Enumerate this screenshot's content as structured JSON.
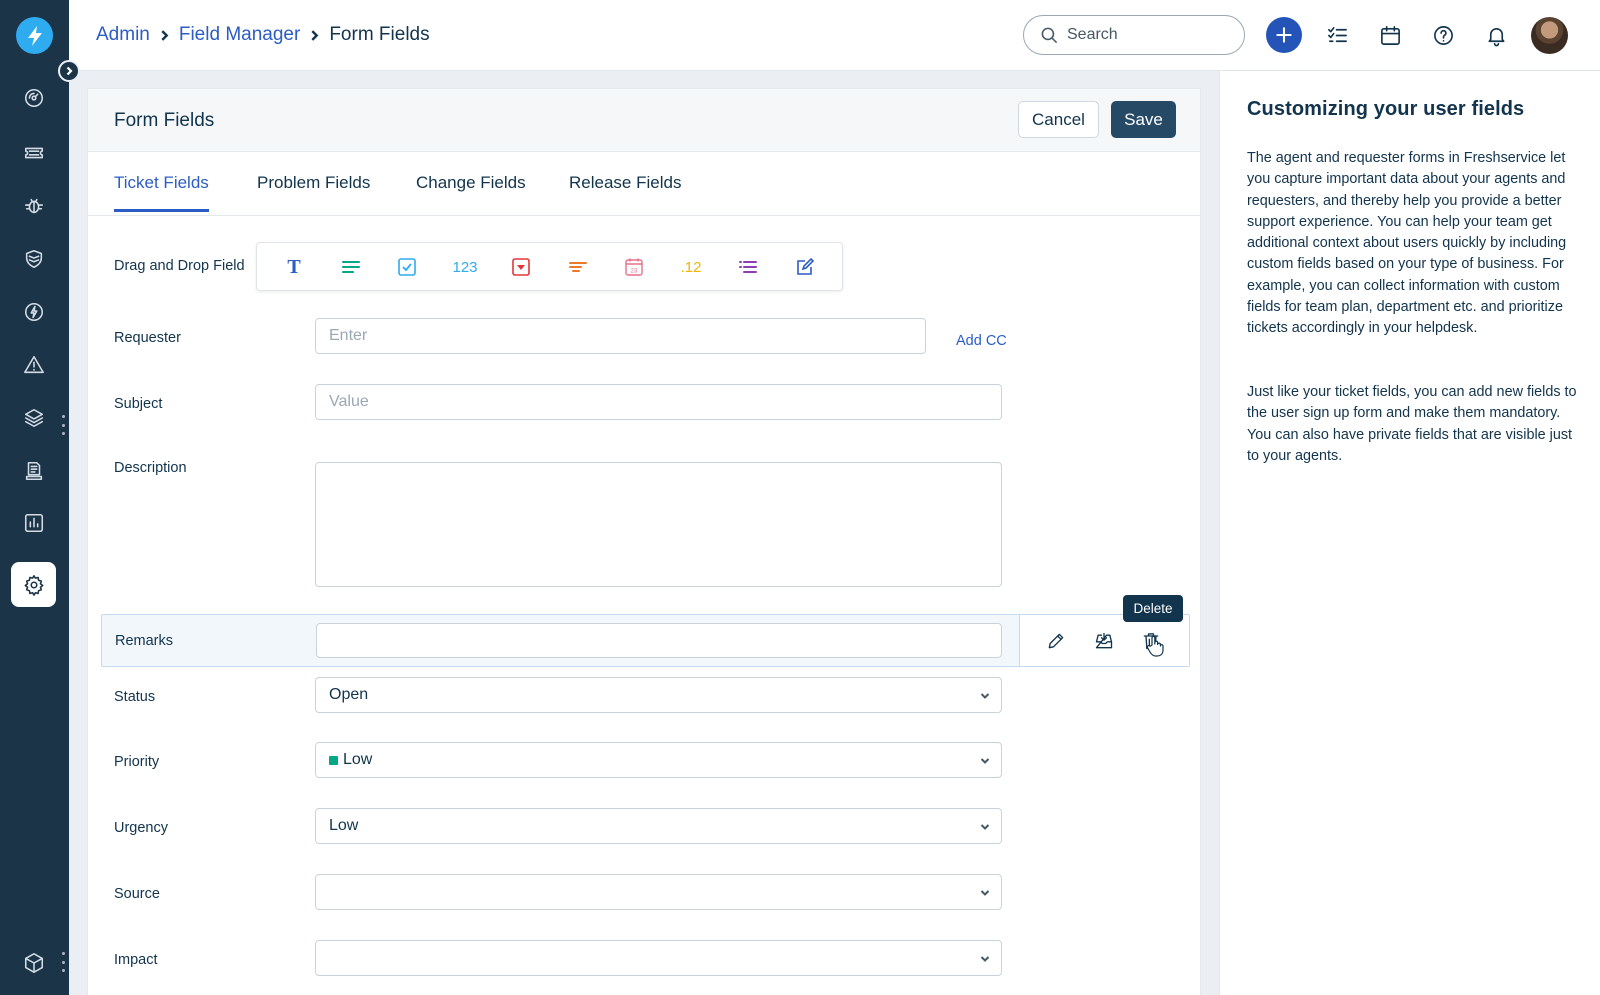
{
  "breadcrumb": {
    "admin": "Admin",
    "field_manager": "Field Manager",
    "current": "Form Fields"
  },
  "search": {
    "placeholder": "Search"
  },
  "card": {
    "title": "Form Fields",
    "cancel_label": "Cancel",
    "save_label": "Save"
  },
  "tabs": [
    {
      "label": "Ticket Fields",
      "active": true
    },
    {
      "label": "Problem Fields"
    },
    {
      "label": "Change Fields"
    },
    {
      "label": "Release Fields"
    }
  ],
  "toolbox": {
    "label": "Drag and Drop Field",
    "tools": [
      {
        "icon": "text-type-icon",
        "text": "T",
        "color": "#2c5cc5"
      },
      {
        "icon": "paragraph-icon",
        "color": "#00a886"
      },
      {
        "icon": "checkbox-icon",
        "color": "#2fabf0"
      },
      {
        "icon": "number-icon",
        "text": "123",
        "color": "#2fabf0"
      },
      {
        "icon": "dropdown-icon",
        "color": "#e43538"
      },
      {
        "icon": "dependent-field-icon",
        "color": "#ec7a2c"
      },
      {
        "icon": "date-icon",
        "text": "23",
        "color": "#e86f8c"
      },
      {
        "icon": "decimal-icon",
        "text": ".12",
        "color": "#f4b400"
      },
      {
        "icon": "list-icon",
        "color": "#8b3fb1"
      },
      {
        "icon": "edit-field-icon",
        "color": "#2c5cc5"
      }
    ]
  },
  "fields": {
    "requester": {
      "label": "Requester",
      "placeholder": "Enter",
      "add_cc": "Add CC"
    },
    "subject": {
      "label": "Subject",
      "placeholder": "Value"
    },
    "description": {
      "label": "Description"
    },
    "remarks": {
      "label": "Remarks",
      "tooltip": "Delete"
    },
    "status": {
      "label": "Status",
      "value": "Open"
    },
    "priority": {
      "label": "Priority",
      "value": "Low",
      "swatch_color": "#00a886"
    },
    "urgency": {
      "label": "Urgency",
      "value": "Low"
    },
    "source": {
      "label": "Source",
      "value": ""
    },
    "impact": {
      "label": "Impact",
      "value": ""
    }
  },
  "help": {
    "title": "Customizing your user fields",
    "p1": "The agent and requester forms in Freshservice let you capture important data about your agents and requesters, and thereby help you provide a better support experience. You can help your team get additional context about users quickly by including custom fields based on your type of business. For example, you can collect information with custom fields for team plan, department etc. and prioritize tickets accordingly in your helpdesk.",
    "p2": "Just like your ticket fields, you can add new fields to the user sign up form and make them mandatory. You can also have private fields that are visible just to your agents."
  },
  "colors": {
    "sidebar": "#1c3447",
    "accent": "#2c5cc5",
    "save_button": "#264966",
    "logo": "#2fabf0"
  }
}
